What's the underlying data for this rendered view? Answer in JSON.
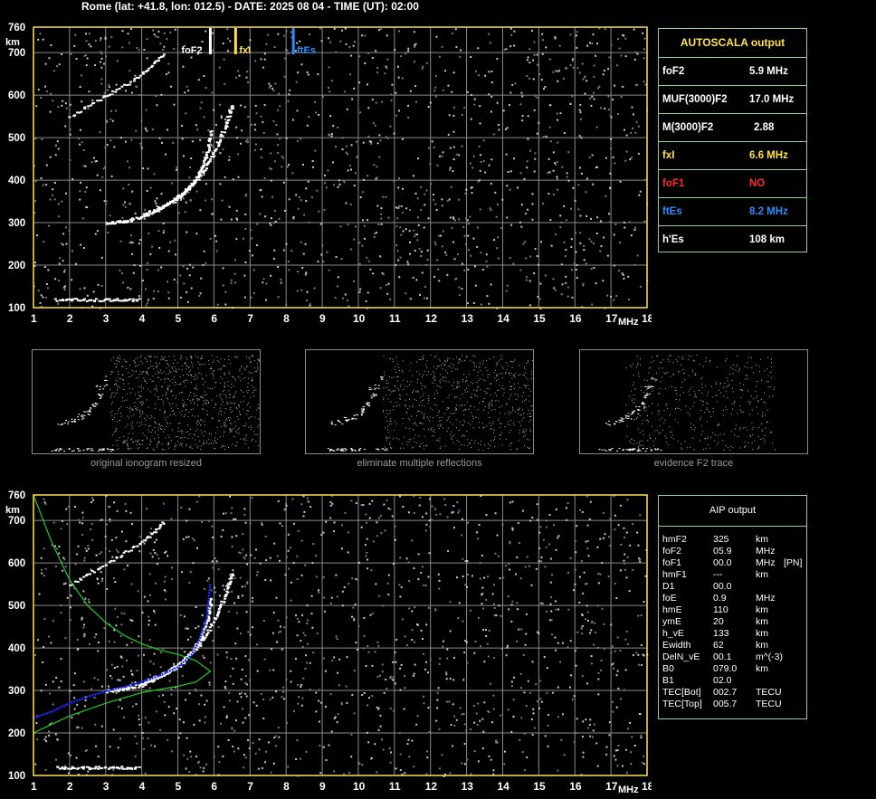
{
  "header": {
    "text": "Rome (lat: +41.8, lon: 012.5) - DATE: 2025 08 04 - TIME (UT): 02:00"
  },
  "colors": {
    "frame": "#ffe24a",
    "grid": "#8a8a8a",
    "box_border": "#8fd48f",
    "white": "#ffffff",
    "yellow": "#ffe24a",
    "red": "#ff2a2a",
    "blue": "#2f8cff",
    "profile_green": "#22cc22",
    "profile_blue": "#1a2cff"
  },
  "axes": {
    "x_ticks": [
      "1",
      "2",
      "3",
      "4",
      "5",
      "6",
      "7",
      "8",
      "9",
      "10",
      "11",
      "12",
      "13",
      "14",
      "15",
      "16",
      "17",
      "18"
    ],
    "x_unit": "MHz",
    "y_ticks": [
      "100",
      "200",
      "300",
      "400",
      "500",
      "600",
      "700",
      "760"
    ],
    "y_unit": "km",
    "xlim": [
      1,
      18
    ],
    "ylim": [
      100,
      760
    ]
  },
  "top_markers": [
    {
      "label": "foF2",
      "freq": 5.9,
      "color": "#ffffff"
    },
    {
      "label": "fxI",
      "freq": 6.6,
      "color": "#ffe24a"
    },
    {
      "label": "ftEs",
      "freq": 8.2,
      "color": "#2f8cff"
    }
  ],
  "autoscala": {
    "title": "AUTOSCALA output",
    "rows": [
      {
        "label": "foF2",
        "value": "5.9 MHz",
        "color": "#ffffff"
      },
      {
        "label": "MUF(3000)F2",
        "value": "17.0 MHz",
        "color": "#ffffff"
      },
      {
        "label": "M(3000)F2",
        "value": "2.88",
        "color": "#ffffff"
      },
      {
        "label": "fxI",
        "value": "6.6 MHz",
        "color": "#ffe24a"
      },
      {
        "label": "foF1",
        "value": "NO",
        "color": "#ff2a2a"
      },
      {
        "label": "ftEs",
        "value": "8.2 MHz",
        "color": "#2f8cff"
      },
      {
        "label": "h'Es",
        "value": "108    km",
        "color": "#ffffff"
      }
    ]
  },
  "thumbnails": [
    {
      "caption": "original ionogram resized"
    },
    {
      "caption": "eliminate multiple reflections"
    },
    {
      "caption": "evidence F2 trace"
    }
  ],
  "aip": {
    "title": "AIP output",
    "rows": [
      {
        "name": "hmF2",
        "value": "325",
        "unit": "km",
        "extra": ""
      },
      {
        "name": "foF2",
        "value": "05.9",
        "unit": "MHz",
        "extra": ""
      },
      {
        "name": "foF1",
        "value": "00.0",
        "unit": "MHz",
        "extra": "[PN]"
      },
      {
        "name": "hmF1",
        "value": "---",
        "unit": "km",
        "extra": ""
      },
      {
        "name": "D1",
        "value": "00.0",
        "unit": "",
        "extra": ""
      },
      {
        "name": "foE",
        "value": "0.9",
        "unit": "MHz",
        "extra": ""
      },
      {
        "name": "hmE",
        "value": "110",
        "unit": "km",
        "extra": ""
      },
      {
        "name": "ymE",
        "value": "20",
        "unit": "km",
        "extra": ""
      },
      {
        "name": "h_vE",
        "value": "133",
        "unit": "km",
        "extra": ""
      },
      {
        "name": "Ewidth",
        "value": "62",
        "unit": "km",
        "extra": ""
      },
      {
        "name": "DelN_vE",
        "value": "00.1",
        "unit": "m^(-3)",
        "extra": ""
      },
      {
        "name": "B0",
        "value": "079.0",
        "unit": "km",
        "extra": ""
      },
      {
        "name": "B1",
        "value": "02.0",
        "unit": "",
        "extra": ""
      },
      {
        "name": "TEC[Bot]",
        "value": "002.7",
        "unit": "TECU",
        "extra": ""
      },
      {
        "name": "TEC[Top]",
        "value": "005.7",
        "unit": "TECU",
        "extra": ""
      }
    ]
  },
  "chart_data": [
    {
      "type": "scatter",
      "title": "",
      "xlabel": "MHz",
      "ylabel": "km",
      "xlim": [
        1,
        18
      ],
      "ylim": [
        100,
        760
      ],
      "grid": true,
      "series": [
        {
          "name": "",
          "points": [
            [
              3.0,
              300
            ],
            [
              3.5,
              305
            ],
            [
              4.0,
              315
            ],
            [
              4.5,
              335
            ],
            [
              5.0,
              360
            ],
            [
              5.3,
              385
            ],
            [
              5.6,
              420
            ],
            [
              5.8,
              470
            ],
            [
              5.9,
              520
            ]
          ]
        },
        {
          "name": "",
          "points": [
            [
              4.0,
              320
            ],
            [
              4.6,
              340
            ],
            [
              5.1,
              370
            ],
            [
              5.6,
              410
            ],
            [
              6.0,
              470
            ],
            [
              6.3,
              530
            ],
            [
              6.5,
              580
            ]
          ]
        },
        {
          "name": "",
          "points": [
            [
              1.6,
              120
            ],
            [
              2.4,
              120
            ],
            [
              3.2,
              120
            ],
            [
              3.9,
              120
            ]
          ]
        },
        {
          "name": "",
          "points": [
            [
              2.0,
              550
            ],
            [
              3.0,
              600
            ],
            [
              4.0,
              650
            ],
            [
              4.6,
              700
            ]
          ]
        }
      ]
    },
    {
      "type": "line",
      "title": "",
      "xlabel": "MHz",
      "ylabel": "km",
      "xlim": [
        1,
        18
      ],
      "ylim": [
        100,
        760
      ],
      "grid": true,
      "series": [
        {
          "name": "",
          "points": [
            [
              1.0,
              760
            ],
            [
              1.5,
              650
            ],
            [
              2.0,
              560
            ],
            [
              2.5,
              500
            ],
            [
              3.0,
              460
            ],
            [
              3.5,
              430
            ],
            [
              4.0,
              410
            ],
            [
              4.5,
              395
            ],
            [
              5.0,
              385
            ],
            [
              5.5,
              370
            ],
            [
              5.9,
              345
            ],
            [
              5.5,
              320
            ],
            [
              5.0,
              310
            ],
            [
              4.0,
              295
            ],
            [
              3.0,
              270
            ],
            [
              2.0,
              240
            ],
            [
              1.5,
              220
            ],
            [
              1.0,
              200
            ]
          ]
        },
        {
          "name": "",
          "points": [
            [
              1.0,
              235
            ],
            [
              1.5,
              250
            ],
            [
              2.0,
              270
            ],
            [
              2.5,
              285
            ],
            [
              3.0,
              298
            ],
            [
              3.5,
              308
            ],
            [
              4.0,
              320
            ],
            [
              4.5,
              335
            ],
            [
              5.0,
              355
            ],
            [
              5.4,
              385
            ],
            [
              5.6,
              420
            ],
            [
              5.8,
              470
            ],
            [
              5.9,
              550
            ]
          ]
        }
      ]
    }
  ]
}
